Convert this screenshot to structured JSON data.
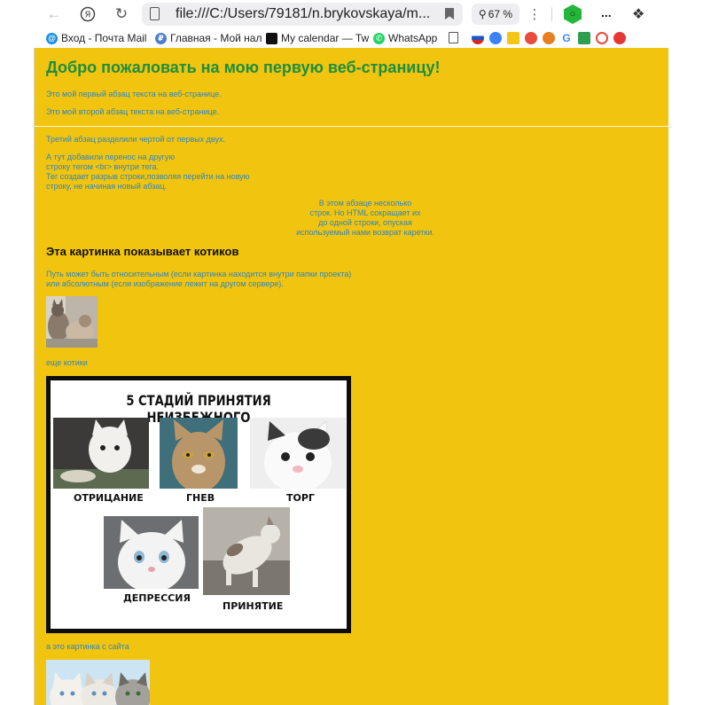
{
  "browser": {
    "address": "file:///C:/Users/79181/n.brykovskaya/m...",
    "zoom_label": "67 %",
    "bookmarks": [
      {
        "label": "Вход - Почта Mail",
        "icon": "mail-icon"
      },
      {
        "label": "Главная - Мой нал",
        "icon": "tax-icon"
      },
      {
        "label": "My calendar — Tw",
        "icon": "calendar-icon"
      },
      {
        "label": "WhatsApp",
        "icon": "whatsapp-icon"
      }
    ]
  },
  "page": {
    "title": "Добро пожаловать на мою первую веб-страницу!",
    "p1": "Это мой первый абзац текста на веб-странице.",
    "p2": "Это мой второй абзац текста на веб-странице.",
    "p3": "Третий абзац разделили чертой от первых двух.",
    "p4_lines": [
      "А тут добавили перенос на другую",
      "строку тегом <br> внутри тега.",
      "Тег создает разрыв строки,позволяя перейти на новую",
      "строку, не начиная новый абзац."
    ],
    "p5_lines": [
      "В этом абзаце несколько",
      "строк. Но HTML сокращает их",
      "до одной строки, опуская",
      "используемый нами возврат каретки."
    ],
    "cats_heading": "Эта картинка показывает котиков",
    "path_lines": [
      "Путь может быть относительным (если картинка находится внутри папки проекта)",
      "или абсолютным (если изображение лежит на другом сервере)."
    ],
    "more_cats": "еще котики",
    "site_image_caption": "а это картинка с сайта"
  },
  "meme": {
    "title": "5 СТАДИЙ ПРИНЯТИЯ НЕИЗБЕЖНОГО",
    "stages": [
      "ОТРИЦАНИЕ",
      "ГНЕВ",
      "ТОРГ",
      "ДЕПРЕССИЯ",
      "ПРИНЯТИЕ"
    ]
  },
  "colors": {
    "page_background": "#f1c40f",
    "heading_green": "#1e8e3e",
    "text_blue": "#2e86c1"
  }
}
